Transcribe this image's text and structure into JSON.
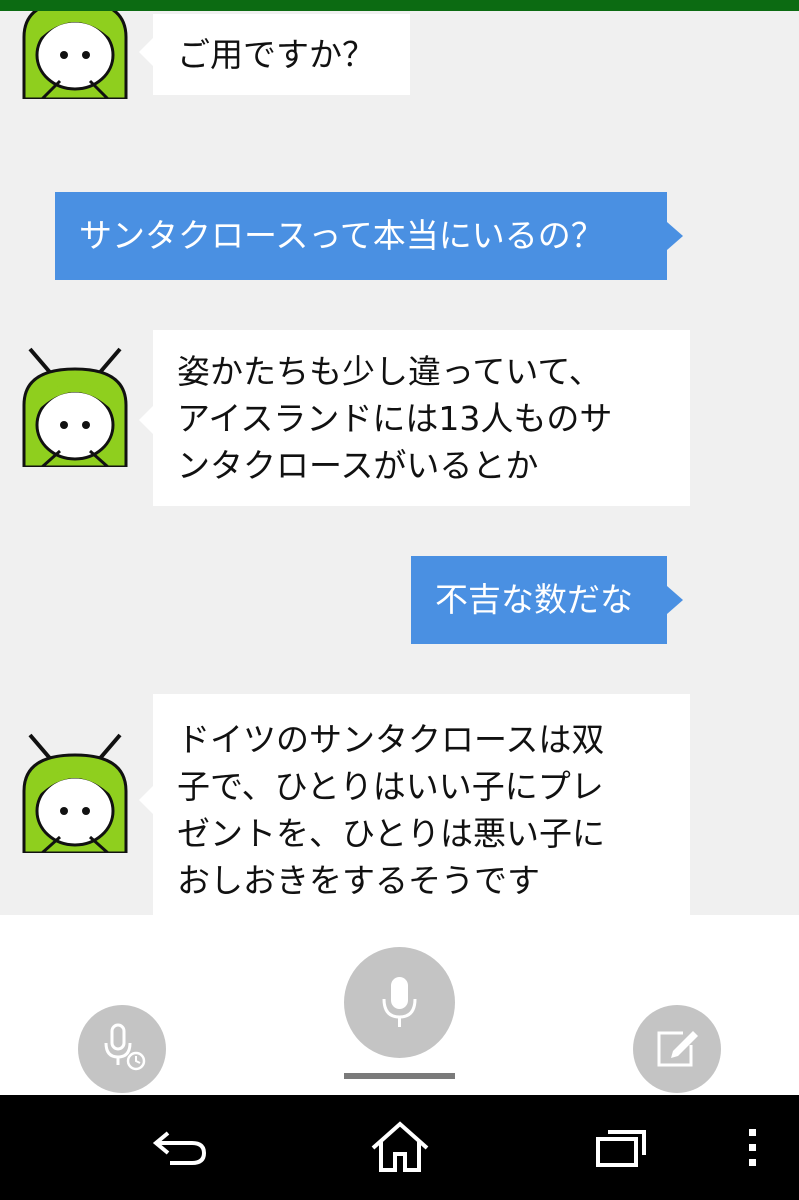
{
  "colors": {
    "status_bar": "#0c6b12",
    "chat_background": "#f0f0f0",
    "bot_bubble": "#ffffff",
    "user_bubble": "#4a90e2",
    "avatar_hair": "#8fcf1e",
    "button_gray": "#c4c4c4",
    "nav_bar": "#000000"
  },
  "messages": {
    "bot1": {
      "lines": [
        "ご用ですか？"
      ]
    },
    "user1": {
      "text": "サンタクロースって本当にいるの？"
    },
    "bot2": {
      "lines": [
        "姿かたちも少し違っていて、",
        "アイスランドには13人ものサ",
        "ンタクロースがいるとか"
      ]
    },
    "user2": {
      "text": "不吉な数だな"
    },
    "bot3": {
      "lines": [
        "ドイツのサンタクロースは双",
        "子で、ひとりはいい子にプレ",
        "ゼントを、ひとりは悪い子に",
        "おしおきをするそうです"
      ]
    }
  },
  "controls": {
    "left_icon": "voice-timer-icon",
    "center_icon": "microphone-icon",
    "right_icon": "edit-icon"
  },
  "navigation": {
    "back_icon": "back-icon",
    "home_icon": "home-icon",
    "recents_icon": "recent-apps-icon",
    "menu_icon": "overflow-menu-icon"
  }
}
